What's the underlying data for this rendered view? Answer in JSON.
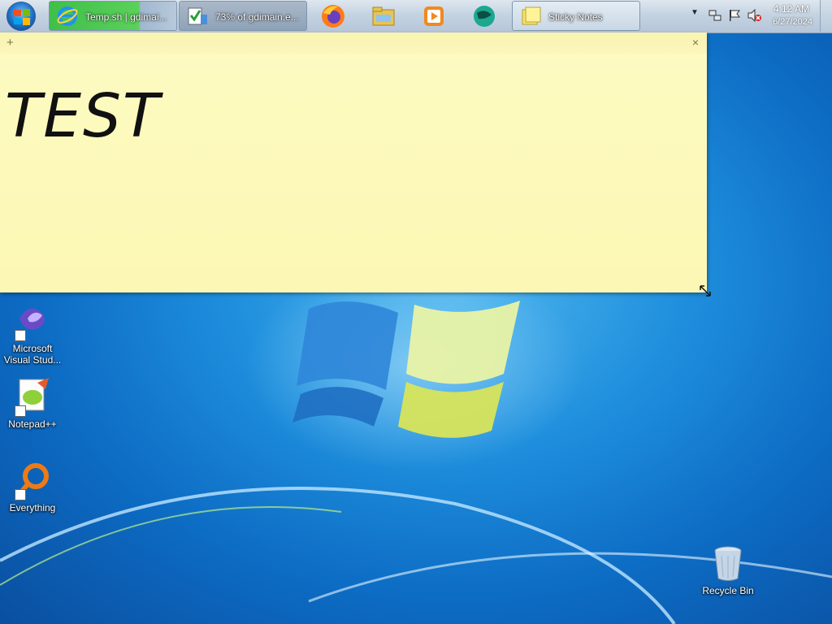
{
  "taskbar": {
    "start_icon": "windows-start-orb",
    "tasks": [
      {
        "label": "Temp.sh | gdimai...",
        "icon": "internet-explorer-icon"
      },
      {
        "label": "73% of gdimain.e...",
        "icon": "download-progress-icon"
      },
      {
        "label": "Sticky Notes",
        "icon": "sticky-notes-icon"
      }
    ],
    "pinned": [
      {
        "name": "firefox-icon"
      },
      {
        "name": "file-explorer-icon"
      },
      {
        "name": "media-player-icon"
      },
      {
        "name": "app-globe-icon"
      }
    ],
    "tray": {
      "overflow_icon": "chevron-up-icon",
      "network_icon": "network-icon",
      "flag_icon": "action-center-flag-icon",
      "volume_icon": "volume-muted-icon",
      "time": "4:12 AM",
      "date": "6/27/2024"
    }
  },
  "sticky_note": {
    "add_symbol": "+",
    "close_symbol": "×",
    "text": "TEST",
    "background": "#fdf9bd"
  },
  "desktop_icons": [
    {
      "label": "Microsoft Visual Stud...",
      "icon": "visual-studio-icon"
    },
    {
      "label": "Notepad++",
      "icon": "notepad-plus-plus-icon"
    },
    {
      "label": "Everything",
      "icon": "everything-search-icon"
    },
    {
      "label": "Recycle Bin",
      "icon": "recycle-bin-icon"
    }
  ]
}
